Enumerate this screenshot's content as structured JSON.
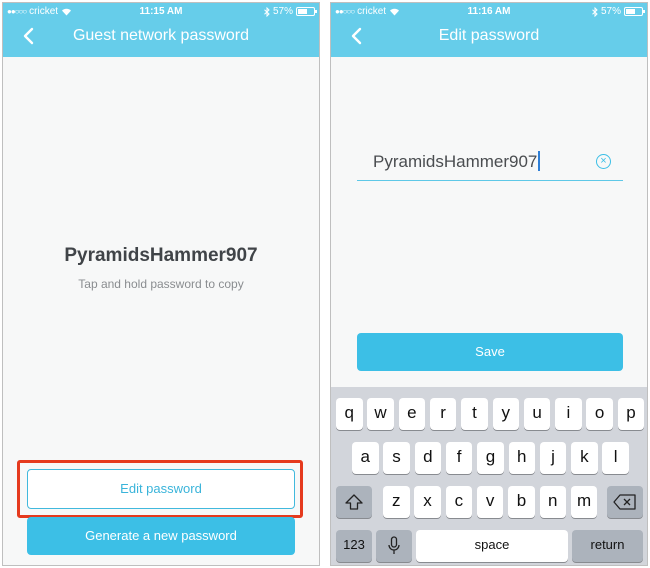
{
  "screen1": {
    "status": {
      "carrier": "cricket",
      "time": "11:15 AM",
      "battery": "57%",
      "battery_level": 0.57
    },
    "title": "Guest network password",
    "password": "PyramidsHammer907",
    "hint": "Tap and hold password to copy",
    "edit_button": "Edit password",
    "generate_button": "Generate a new password",
    "highlight_color": "#e53a1e"
  },
  "screen2": {
    "status": {
      "carrier": "cricket",
      "time": "11:16 AM",
      "battery": "57%",
      "battery_level": 0.57
    },
    "title": "Edit password",
    "password_value": "PyramidsHammer907",
    "save_button": "Save",
    "keyboard": {
      "row1": [
        "q",
        "w",
        "e",
        "r",
        "t",
        "y",
        "u",
        "i",
        "o",
        "p"
      ],
      "row2": [
        "a",
        "s",
        "d",
        "f",
        "g",
        "h",
        "j",
        "k",
        "l"
      ],
      "row3": [
        "z",
        "x",
        "c",
        "v",
        "b",
        "n",
        "m"
      ],
      "numbers_key": "123",
      "space_key": "space",
      "return_key": "return"
    }
  },
  "colors": {
    "header": "#66cdea",
    "accent": "#3cbfe6",
    "text_dark": "#404448",
    "keyboard_bg": "#d2d5db"
  },
  "icons": [
    "back-chevron-icon",
    "wifi-icon",
    "bluetooth-icon",
    "battery-icon",
    "clear-icon",
    "shift-icon",
    "backspace-icon",
    "microphone-icon"
  ]
}
